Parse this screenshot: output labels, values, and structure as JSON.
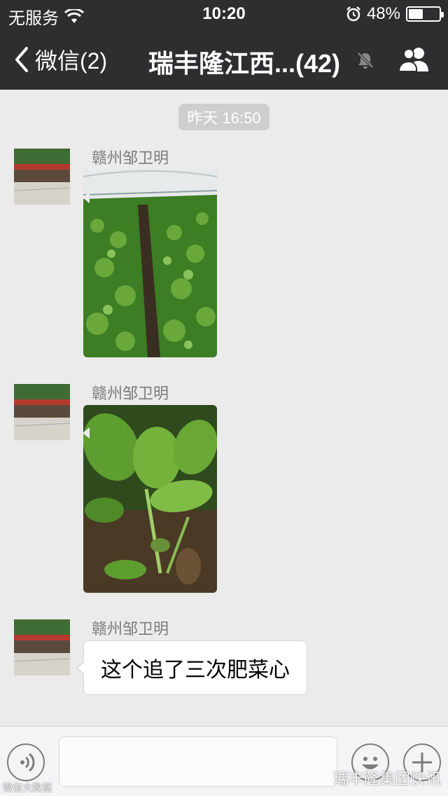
{
  "status_bar": {
    "carrier": "无服务",
    "time": "10:20",
    "battery_percent": "48%",
    "battery_level": 0.48,
    "icons": [
      "wifi-icon",
      "alarm-icon",
      "battery-icon"
    ]
  },
  "nav": {
    "back_label": "微信(2)",
    "title": "瑞丰隆江西...(42)",
    "icons": [
      "back-chevron-icon",
      "mute-bell-icon",
      "group-members-icon"
    ]
  },
  "chat": {
    "timestamp": "昨天 16:50",
    "messages": [
      {
        "sender": "赣州邹卫明",
        "type": "image",
        "image_desc": "greenhouse-seedlings"
      },
      {
        "sender": "赣州邹卫明",
        "type": "image",
        "image_desc": "vegetable-leaves"
      },
      {
        "sender": "赣州邹卫明",
        "type": "text",
        "text": "这个追了三次肥菜心"
      }
    ]
  },
  "input_bar": {
    "value": "",
    "icons": [
      "voice-icon",
      "emoji-icon",
      "plus-icon"
    ]
  },
  "watermarks": {
    "left": "微信大数据",
    "right": "瑞丰隆集团快讯"
  },
  "colors": {
    "nav_bg": "#2e2e31",
    "chat_bg": "#ebebeb",
    "timestamp_bg": "#cecece"
  }
}
